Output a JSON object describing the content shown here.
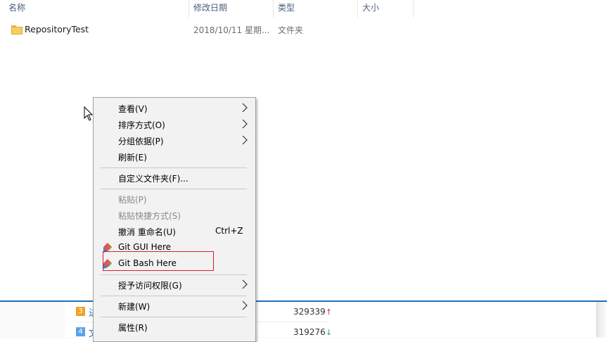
{
  "explorer": {
    "columns": {
      "name": "名称",
      "modified": "修改日期",
      "type": "类型",
      "size": "大小"
    },
    "files": [
      {
        "name": "RepositoryTest",
        "modified": "2018/10/11 星期...",
        "type": "文件夹"
      }
    ]
  },
  "context_menu": {
    "items": {
      "view": "查看(V)",
      "sort_by": "排序方式(O)",
      "group_by": "分组依据(P)",
      "refresh": "刷新(E)",
      "customize_folder": "自定义文件夹(F)...",
      "paste": "粘贴(P)",
      "paste_shortcut": "粘贴快捷方式(S)",
      "undo_rename": "撤消 重命名(U)",
      "undo_shortcut": "Ctrl+Z",
      "git_gui": "Git GUI Here",
      "git_bash": "Git Bash Here",
      "give_access": "授予访问权限(G)",
      "new": "新建(W)",
      "properties": "属性(R)"
    },
    "highlighted_item": "Git Bash Here",
    "highlight_color": "#d4202a"
  },
  "background": {
    "rows": [
      {
        "rank": "3",
        "text": "进",
        "count": "329339",
        "trend": "↑"
      },
      {
        "rank": "4",
        "text": "文",
        "count": "319276",
        "trend": "↓"
      }
    ]
  }
}
